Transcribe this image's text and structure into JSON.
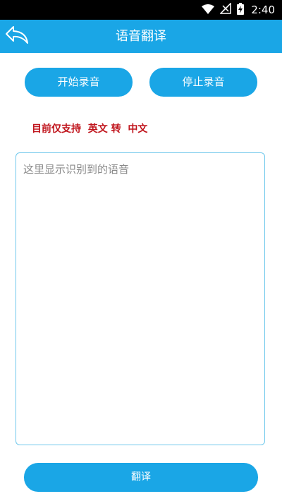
{
  "status_bar": {
    "time": "2:40",
    "icons": [
      "wifi-icon",
      "signal-icon",
      "battery-charging-icon"
    ]
  },
  "header": {
    "title": "语音翻译",
    "back_icon": "back-arrow-icon"
  },
  "controls": {
    "start_label": "开始录音",
    "stop_label": "停止录音"
  },
  "notice": {
    "text": "目前仅支持  英文 转  中文"
  },
  "speech_box": {
    "value": "",
    "placeholder": "这里显示识别到的语音"
  },
  "translate_label": "翻译",
  "colors": {
    "accent": "#1aa6e6",
    "notice": "#c0141c",
    "border": "#6fc8ec",
    "status_bar": "#000000"
  }
}
